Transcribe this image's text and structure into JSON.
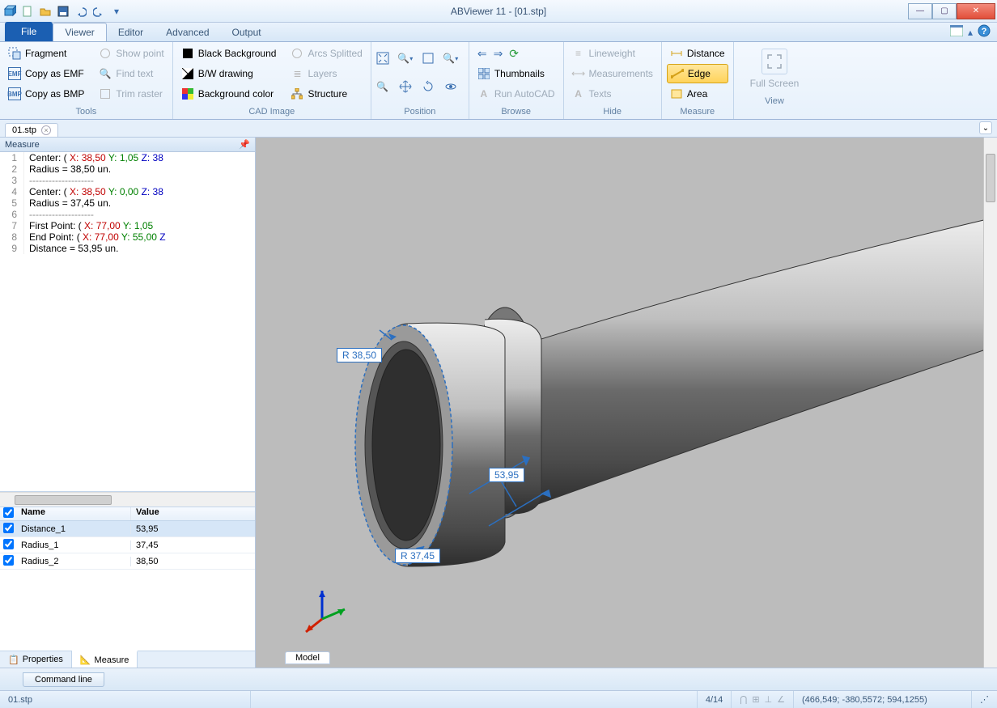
{
  "app": {
    "title": "ABViewer 11 - [01.stp]"
  },
  "qat_icons": [
    "cube",
    "new",
    "open",
    "save",
    "undo",
    "redo",
    "dropdown"
  ],
  "tabs": {
    "file": "File",
    "list": [
      "Viewer",
      "Editor",
      "Advanced",
      "Output"
    ],
    "active": "Viewer"
  },
  "ribbon": {
    "tools": {
      "caption": "Tools",
      "items": [
        {
          "label": "Fragment",
          "icon": "fragment-icon"
        },
        {
          "label": "Copy as EMF",
          "icon": "copy-emf-icon"
        },
        {
          "label": "Copy as BMP",
          "icon": "copy-bmp-icon"
        },
        {
          "label": "Show point",
          "icon": "show-point-icon",
          "disabled": true
        },
        {
          "label": "Find text",
          "icon": "find-text-icon",
          "disabled": true
        },
        {
          "label": "Trim raster",
          "icon": "trim-raster-icon",
          "disabled": true
        }
      ]
    },
    "cadimage": {
      "caption": "CAD Image",
      "items": [
        {
          "label": "Black Background",
          "icon": "black-bg-icon"
        },
        {
          "label": "B/W drawing",
          "icon": "bw-drawing-icon"
        },
        {
          "label": "Background color",
          "icon": "bg-color-icon"
        },
        {
          "label": "Arcs Splitted",
          "icon": "arcs-icon",
          "disabled": true
        },
        {
          "label": "Layers",
          "icon": "layers-icon",
          "disabled": true
        },
        {
          "label": "Structure",
          "icon": "structure-icon"
        }
      ]
    },
    "position": {
      "caption": "Position",
      "icons": [
        "fit",
        "zoom-window",
        "zoom-in",
        "pan",
        "zoom-extents",
        "rotate",
        "zoom-out",
        "orbit"
      ]
    },
    "browse": {
      "caption": "Browse",
      "items": [
        {
          "icon": "back-icon"
        },
        {
          "icon": "fwd-icon"
        },
        {
          "icon": "reload-icon"
        },
        {
          "label": "Thumbnails",
          "icon": "thumbnails-icon"
        },
        {
          "label": "Run AutoCAD",
          "icon": "autocad-icon",
          "disabled": true
        }
      ]
    },
    "hide": {
      "caption": "Hide",
      "items": [
        {
          "label": "Lineweight",
          "icon": "lineweight-icon",
          "disabled": true
        },
        {
          "label": "Measurements",
          "icon": "measurements-icon",
          "disabled": true
        },
        {
          "label": "Texts",
          "icon": "texts-icon",
          "disabled": true
        }
      ]
    },
    "measure": {
      "caption": "Measure",
      "items": [
        {
          "label": "Distance",
          "icon": "distance-icon"
        },
        {
          "label": "Edge",
          "icon": "edge-icon",
          "active": true
        },
        {
          "label": "Area",
          "icon": "area-icon"
        }
      ]
    },
    "view": {
      "caption": "View",
      "big_label": "Full Screen"
    }
  },
  "doc_tab": "01.stp",
  "measure_panel": {
    "title": "Measure",
    "log": [
      {
        "n": 1,
        "segments": [
          {
            "t": "Center: ( ",
            "c": "kw"
          },
          {
            "t": "X: 38,50",
            "c": "xc"
          },
          {
            "t": " ",
            "c": "kw"
          },
          {
            "t": "Y: 1,05",
            "c": "yc"
          },
          {
            "t": " ",
            "c": "kw"
          },
          {
            "t": "Z: 38",
            "c": "zc"
          }
        ]
      },
      {
        "n": 2,
        "segments": [
          {
            "t": "Radius = 38,50 un.",
            "c": "kw"
          }
        ]
      },
      {
        "n": 3,
        "segments": [
          {
            "t": "--------------------",
            "c": "sep"
          }
        ]
      },
      {
        "n": 4,
        "segments": [
          {
            "t": "Center: ( ",
            "c": "kw"
          },
          {
            "t": "X: 38,50",
            "c": "xc"
          },
          {
            "t": " ",
            "c": "kw"
          },
          {
            "t": "Y: 0,00",
            "c": "yc"
          },
          {
            "t": " ",
            "c": "kw"
          },
          {
            "t": "Z: 38",
            "c": "zc"
          }
        ]
      },
      {
        "n": 5,
        "segments": [
          {
            "t": "Radius = 37,45 un.",
            "c": "kw"
          }
        ]
      },
      {
        "n": 6,
        "segments": [
          {
            "t": "--------------------",
            "c": "sep"
          }
        ]
      },
      {
        "n": 7,
        "segments": [
          {
            "t": "First Point: ( ",
            "c": "kw"
          },
          {
            "t": "X: 77,00",
            "c": "xc"
          },
          {
            "t": " ",
            "c": "kw"
          },
          {
            "t": "Y: 1,05",
            "c": "yc"
          }
        ]
      },
      {
        "n": 8,
        "segments": [
          {
            "t": "End Point: ( ",
            "c": "kw"
          },
          {
            "t": "X: 77,00",
            "c": "xc"
          },
          {
            "t": " ",
            "c": "kw"
          },
          {
            "t": "Y: 55,00",
            "c": "yc"
          },
          {
            "t": " ",
            "c": "kw"
          },
          {
            "t": "Z",
            "c": "zc"
          }
        ]
      },
      {
        "n": 9,
        "segments": [
          {
            "t": "Distance = 53,95 un.",
            "c": "kw"
          }
        ]
      }
    ],
    "table": {
      "headers": {
        "name": "Name",
        "value": "Value"
      },
      "rows": [
        {
          "name": "Distance_1",
          "value": "53,95",
          "selected": true
        },
        {
          "name": "Radius_1",
          "value": "37,45"
        },
        {
          "name": "Radius_2",
          "value": "38,50"
        }
      ]
    },
    "tabs": {
      "properties": "Properties",
      "measure": "Measure"
    }
  },
  "viewport": {
    "dims": {
      "r1": "R 38,50",
      "r2": "R 37,45",
      "d": "53,95"
    },
    "model_tab": "Model"
  },
  "cmdbar": {
    "label": "Command line"
  },
  "status": {
    "file": "01.stp",
    "page": "4/14",
    "coords": "(466,549; -380,5572; 594,1255)"
  }
}
